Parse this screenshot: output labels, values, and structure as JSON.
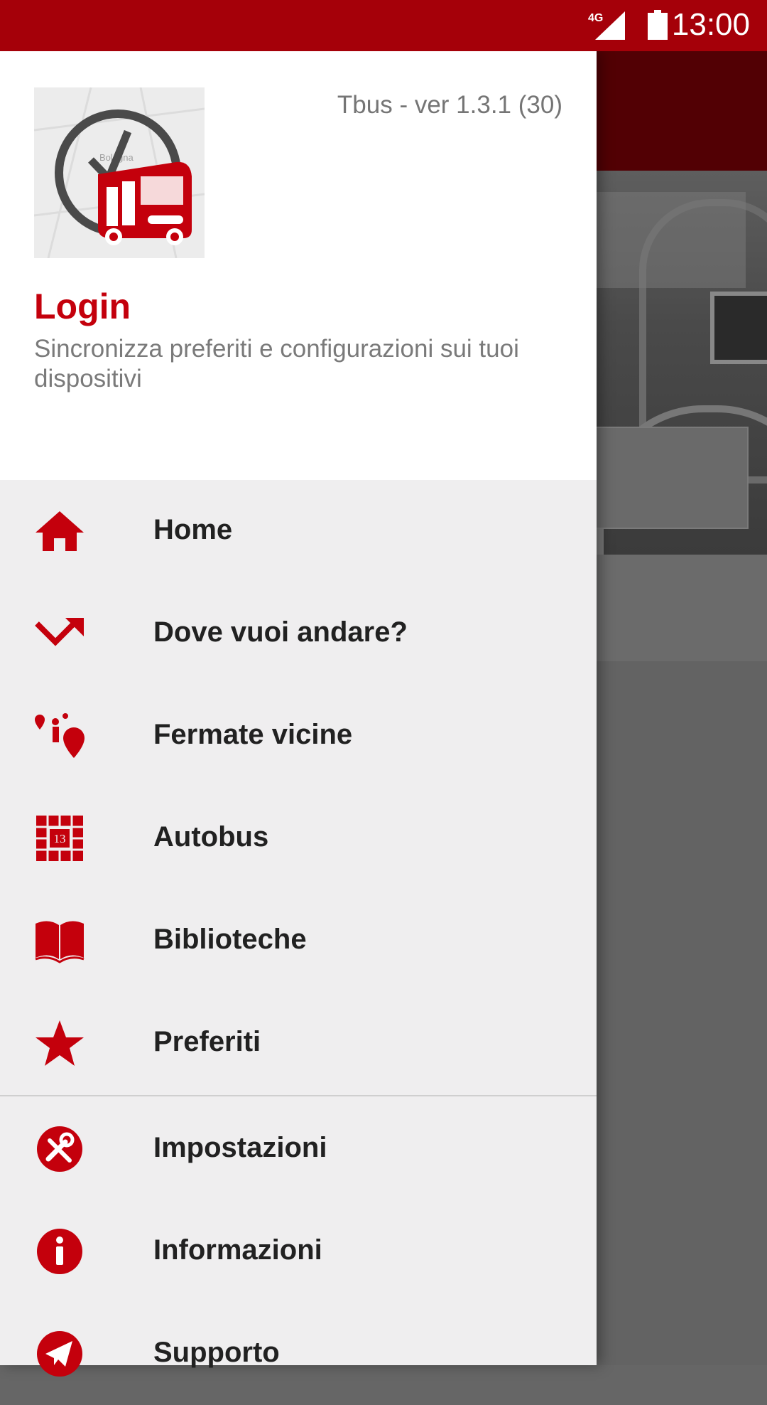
{
  "status_bar": {
    "network": "4G",
    "time": "13:00"
  },
  "drawer": {
    "version": "Tbus - ver 1.3.1 (30)",
    "login_title": "Login",
    "login_subtitle": "Sincronizza preferiti e configurazioni sui tuoi dispositivi",
    "logo_map_text": "Bologna"
  },
  "menu": {
    "primary": [
      {
        "label": "Home",
        "icon": "home-icon"
      },
      {
        "label": "Dove vuoi andare?",
        "icon": "route-arrow-icon"
      },
      {
        "label": "Fermate vicine",
        "icon": "nearby-stops-icon"
      },
      {
        "label": "Autobus",
        "icon": "calendar-grid-icon",
        "icon_text": "13"
      },
      {
        "label": "Biblioteche",
        "icon": "book-icon"
      },
      {
        "label": "Preferiti",
        "icon": "star-icon"
      }
    ],
    "secondary": [
      {
        "label": "Impostazioni",
        "icon": "tools-icon"
      },
      {
        "label": "Informazioni",
        "icon": "info-icon"
      },
      {
        "label": "Supporto",
        "icon": "paper-plane-icon"
      }
    ]
  },
  "colors": {
    "accent": "#c4000c",
    "status_bar": "#a50009",
    "drawer_bg": "#efeeef",
    "header_bg": "#ffffff"
  }
}
